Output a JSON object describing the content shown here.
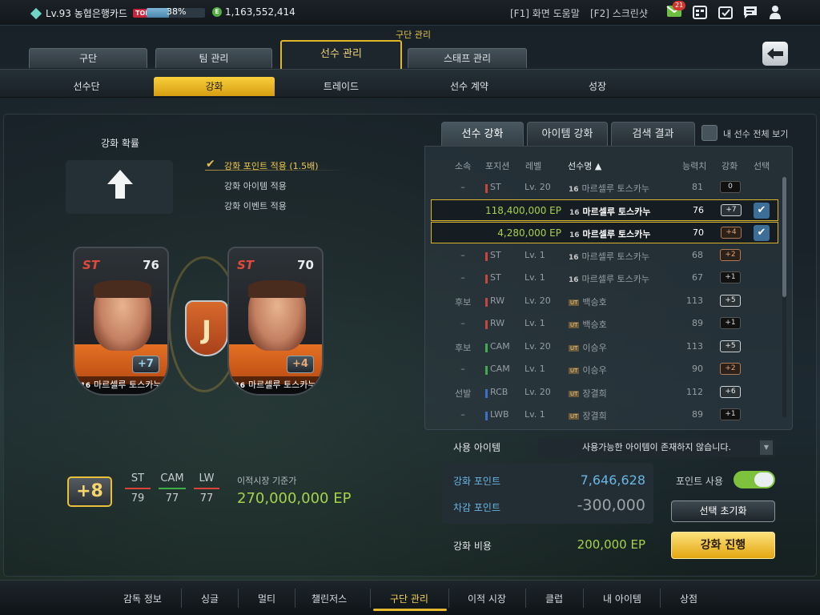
{
  "topbar": {
    "level": "Lv.93 농협은행카드",
    "top_badge": "TOP",
    "xp_percent": "38%",
    "xp_fraction": 0.38,
    "ep_badge": "E",
    "ep_amount": "1,163,552,414",
    "help_key": "[F1] 화면 도움말",
    "screenshot_key": "[F2] 스크린샷",
    "mail_count": "21",
    "icons": [
      "mail-icon",
      "calendar-icon",
      "checklist-icon",
      "chat-icon",
      "user-icon"
    ]
  },
  "header": {
    "section_label": "구단 관리",
    "main_tabs": [
      {
        "label": "구단"
      },
      {
        "label": "팀 관리"
      },
      {
        "label": "선수 관리"
      },
      {
        "label": "스태프 관리"
      }
    ],
    "sub_tabs": [
      {
        "label": "선수단"
      },
      {
        "label": "강화"
      },
      {
        "label": "트레이드"
      },
      {
        "label": "선수 계약"
      },
      {
        "label": "성장"
      }
    ],
    "back_icon": "back-arrow-icon"
  },
  "enhance": {
    "rate_label": "강화 확률",
    "options": [
      {
        "label": "강화 포인트 적용 (1.5배)",
        "checked": true
      },
      {
        "label": "강화 아이템 적용",
        "checked": false
      },
      {
        "label": "강화 이벤트 적용",
        "checked": false
      }
    ],
    "cards": [
      {
        "position": "ST",
        "ovr": "76",
        "grade": "+7",
        "season": "16",
        "name": "마르셀루 토스카누"
      },
      {
        "position": "ST",
        "ovr": "70",
        "grade": "+4",
        "season": "16",
        "name": "마르셀루 토스카누"
      }
    ],
    "club_emblem_text": "J",
    "result_grade": "+8",
    "result_positions": [
      {
        "pos": "ST",
        "val": "79",
        "color": "#d8443a"
      },
      {
        "pos": "CAM",
        "val": "77",
        "color": "#3fae4a"
      },
      {
        "pos": "LW",
        "val": "77",
        "color": "#d8443a"
      }
    ],
    "market_label": "이적시장 기준가",
    "market_value": "270,000,000 EP"
  },
  "list": {
    "tabs": [
      {
        "label": "선수 강화"
      },
      {
        "label": "아이템 강화"
      },
      {
        "label": "검색 결과"
      }
    ],
    "show_all_label": "내 선수 전체 보기",
    "headers": {
      "affiliation": "소속",
      "position": "포지션",
      "level": "레벨",
      "name": "선수명 ▲",
      "ability": "능력치",
      "grade": "강화",
      "select": "선택"
    },
    "rows": [
      {
        "affiliation": "–",
        "position": "ST",
        "pos_color": "#c8453b",
        "level": "Lv. 20",
        "season": "16",
        "name": "마르셀루 토스카누",
        "ability": "81",
        "grade": "0",
        "grade_style": "black",
        "price": "",
        "selected": false
      },
      {
        "affiliation": "",
        "position": "",
        "pos_color": "",
        "level": "",
        "season": "16",
        "name": "마르셀루 토스카누",
        "ability": "76",
        "grade": "+7",
        "grade_style": "silver",
        "price": "118,400,000 EP",
        "selected": true
      },
      {
        "affiliation": "",
        "position": "",
        "pos_color": "",
        "level": "",
        "season": "16",
        "name": "마르셀루 토스카누",
        "ability": "70",
        "grade": "+4",
        "grade_style": "bronze",
        "price": "4,280,000 EP",
        "selected": true
      },
      {
        "affiliation": "–",
        "position": "ST",
        "pos_color": "#c8453b",
        "level": "Lv. 1",
        "season": "16",
        "name": "마르셀루 토스카누",
        "ability": "68",
        "grade": "+2",
        "grade_style": "bronze",
        "price": "",
        "selected": false
      },
      {
        "affiliation": "–",
        "position": "ST",
        "pos_color": "#c8453b",
        "level": "Lv. 1",
        "season": "16",
        "name": "마르셀루 토스카누",
        "ability": "67",
        "grade": "+1",
        "grade_style": "black",
        "price": "",
        "selected": false
      },
      {
        "affiliation": "후보",
        "position": "RW",
        "pos_color": "#c8453b",
        "level": "Lv. 20",
        "season": "UT",
        "name": "백승호",
        "ability": "113",
        "grade": "+5",
        "grade_style": "silver",
        "price": "",
        "selected": false
      },
      {
        "affiliation": "–",
        "position": "RW",
        "pos_color": "#c8453b",
        "level": "Lv. 1",
        "season": "UT",
        "name": "백승호",
        "ability": "89",
        "grade": "+1",
        "grade_style": "black",
        "price": "",
        "selected": false
      },
      {
        "affiliation": "후보",
        "position": "CAM",
        "pos_color": "#3fae4a",
        "level": "Lv. 20",
        "season": "UT",
        "name": "이승우",
        "ability": "113",
        "grade": "+5",
        "grade_style": "silver",
        "price": "",
        "selected": false
      },
      {
        "affiliation": "–",
        "position": "CAM",
        "pos_color": "#3fae4a",
        "level": "Lv. 1",
        "season": "UT",
        "name": "이승우",
        "ability": "90",
        "grade": "+2",
        "grade_style": "bronze",
        "price": "",
        "selected": false
      },
      {
        "affiliation": "선발",
        "position": "RCB",
        "pos_color": "#3c6fc9",
        "level": "Lv. 20",
        "season": "UT",
        "name": "장결희",
        "ability": "112",
        "grade": "+6",
        "grade_style": "silver",
        "price": "",
        "selected": false
      },
      {
        "affiliation": "–",
        "position": "LWB",
        "pos_color": "#3c6fc9",
        "level": "Lv. 1",
        "season": "UT",
        "name": "장결희",
        "ability": "89",
        "grade": "+1",
        "grade_style": "black",
        "price": "",
        "selected": false
      }
    ]
  },
  "items": {
    "label": "사용 아이템",
    "select_value": "사용가능한 아이템이 존재하지 않습니다.",
    "points_label": "강화 포인트",
    "points_value": "7,646,628",
    "deduct_label": "차감 포인트",
    "deduct_value": "-300,000",
    "use_points_label": "포인트 사용",
    "use_points_on": true,
    "reset_label": "선택 초기화",
    "cost_label": "강화 비용",
    "cost_value": "200,000 EP",
    "enhance_label": "강화 진행"
  },
  "bottom_nav": {
    "items": [
      {
        "label": "감독 정보"
      },
      {
        "label": "싱글"
      },
      {
        "label": "멀티"
      },
      {
        "label": "챌린저스"
      },
      {
        "label": "구단 관리"
      },
      {
        "label": "이적 시장"
      },
      {
        "label": "클럽"
      },
      {
        "label": "내 아이템"
      },
      {
        "label": "상점"
      }
    ],
    "active": "구단 관리"
  },
  "colors": {
    "accent": "#e3b62a",
    "ep_green": "#a6d24b",
    "point_blue": "#6ab6e2"
  }
}
